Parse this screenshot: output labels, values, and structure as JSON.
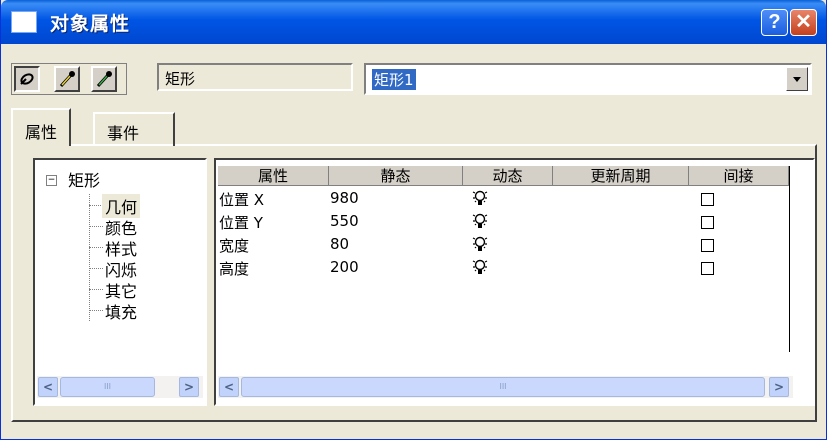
{
  "window": {
    "title": "对象属性",
    "help_label": "?",
    "close_label": "✕"
  },
  "toolbar": {
    "tools": [
      "pin-icon",
      "eyedropper-icon",
      "eyedropper-alt-icon"
    ]
  },
  "object": {
    "type": "矩形",
    "name": "矩形1"
  },
  "tabs": [
    {
      "label": "属性",
      "active": true
    },
    {
      "label": "事件",
      "active": false
    }
  ],
  "tree": {
    "expander": "−",
    "root": "矩形",
    "items": [
      "几何",
      "颜色",
      "样式",
      "闪烁",
      "其它",
      "填充"
    ],
    "selected": "几何"
  },
  "grid": {
    "columns": [
      "属性",
      "静态",
      "动态",
      "更新周期",
      "间接"
    ],
    "rows": [
      {
        "property": "位置 X",
        "static": "980",
        "dynamic": "lightbulb-icon",
        "update_cycle": "",
        "indirect": false
      },
      {
        "property": "位置 Y",
        "static": "550",
        "dynamic": "lightbulb-icon",
        "update_cycle": "",
        "indirect": false
      },
      {
        "property": "宽度",
        "static": "80",
        "dynamic": "lightbulb-icon",
        "update_cycle": "",
        "indirect": false
      },
      {
        "property": "高度",
        "static": "200",
        "dynamic": "lightbulb-icon",
        "update_cycle": "",
        "indirect": false
      }
    ]
  },
  "scrollbars": {
    "left_arrow": "<",
    "right_arrow": ">",
    "thumb_grip": "III"
  },
  "colors": {
    "titlebar": "#0055e5",
    "selection": "#316ac5",
    "face": "#ece9d8"
  }
}
